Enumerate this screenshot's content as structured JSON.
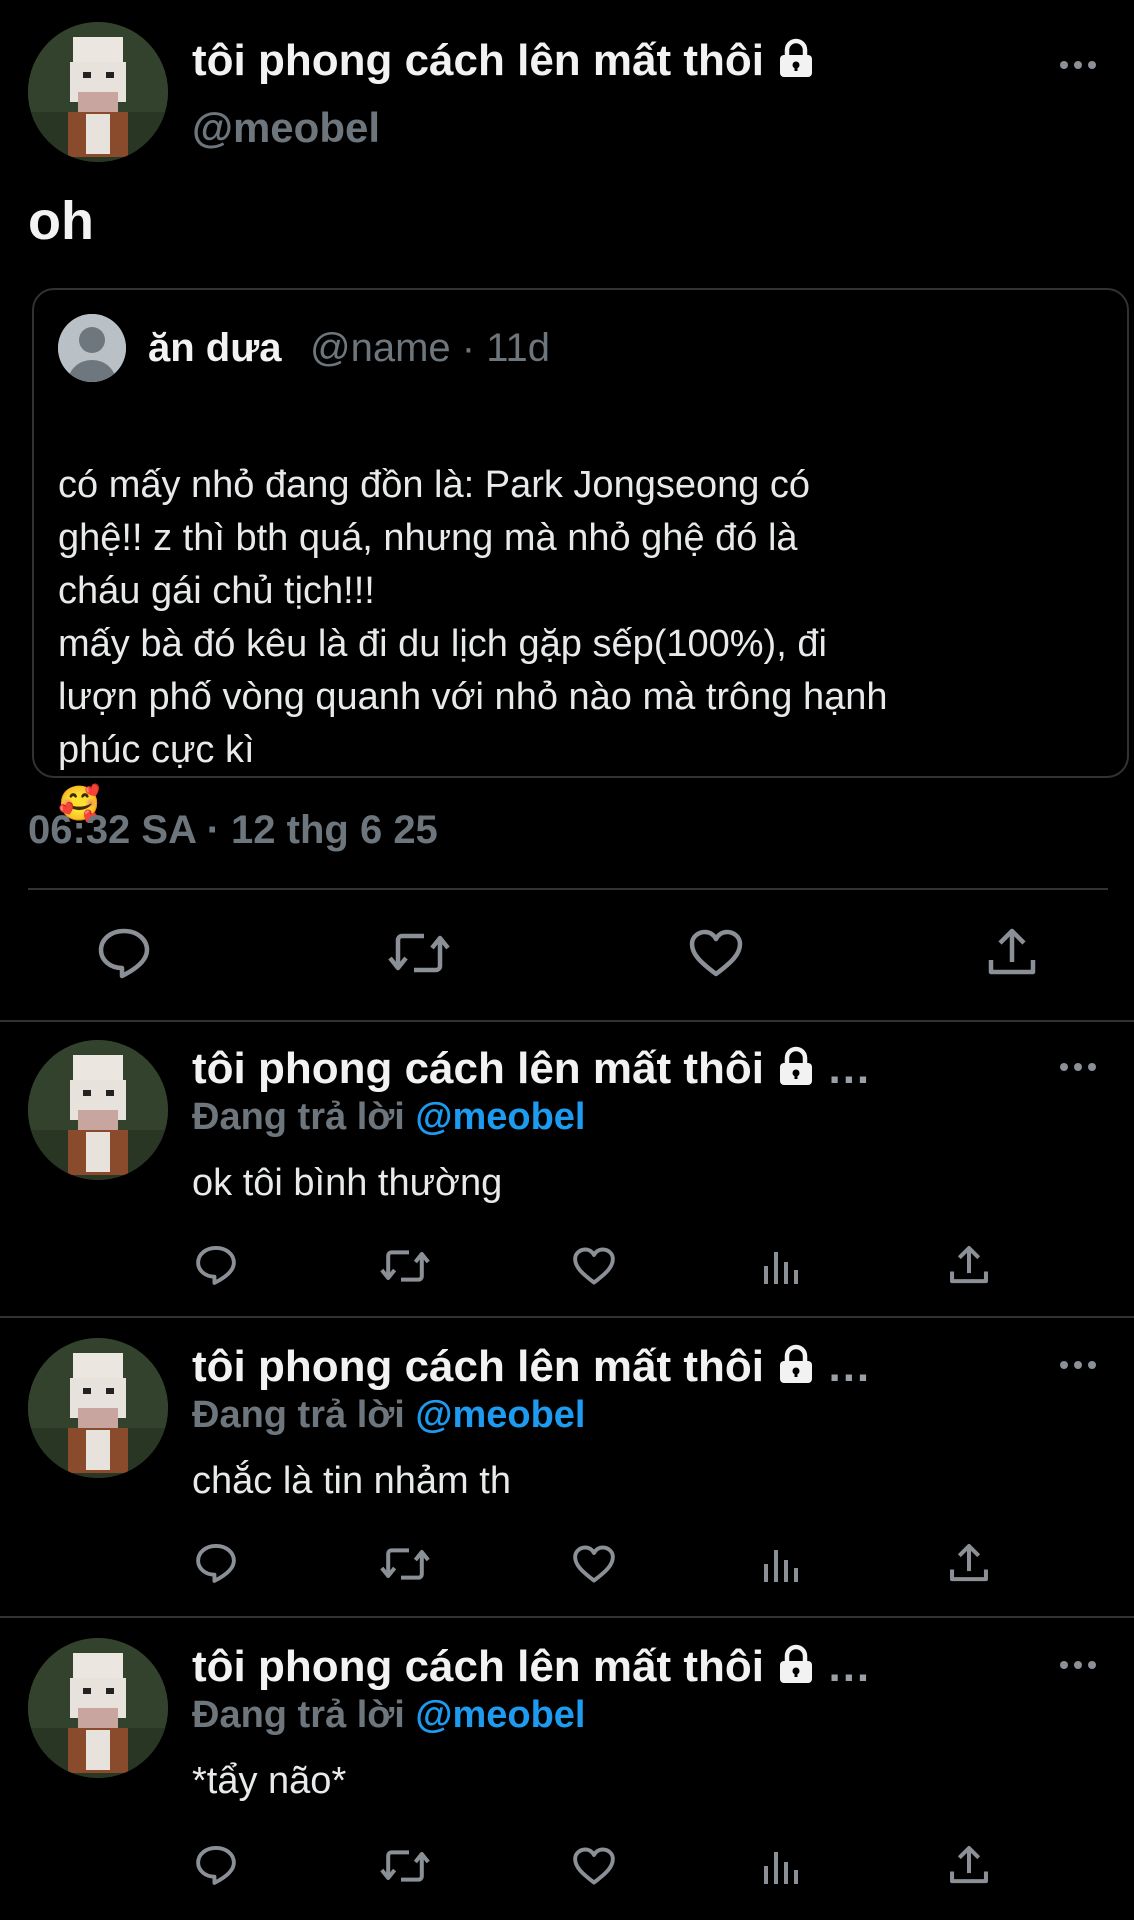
{
  "main_tweet": {
    "display_name": "tôi phong cách lên mất thôi",
    "handle": "@meobel",
    "text": "oh",
    "timestamp": "06:32 SA · 12 thg 6 25",
    "icons": {
      "lock": "lock-icon",
      "more": "more-icon",
      "reply": "reply-icon",
      "retweet": "retweet-icon",
      "like": "like-icon",
      "share": "share-icon"
    }
  },
  "quoted_tweet": {
    "display_name": "ăn dưa",
    "handle_time": "@name · 11d",
    "text": "có mấy nhỏ đang đồn là: Park Jongseong có\nghệ!! z thì bth quá, nhưng mà nhỏ ghệ đó là\ncháu gái chủ tịch!!!\nmấy bà đó kêu là đi du lịch gặp sếp(100%), đi\nlượn phố vòng quanh với nhỏ nào mà trông hạnh\nphúc cực kì",
    "emoji": "🥰"
  },
  "replies": [
    {
      "display_name": "tôi phong cách lên mất thôi",
      "ellipsis": "...",
      "replying_prefix": "Đang trả lời",
      "replying_handle": "@meobel",
      "text": "ok tôi bình thường"
    },
    {
      "display_name": "tôi phong cách lên mất thôi",
      "ellipsis": "...",
      "replying_prefix": "Đang trả lời",
      "replying_handle": "@meobel",
      "text": "chắc là tin nhảm th"
    },
    {
      "display_name": "tôi phong cách lên mất thôi",
      "ellipsis": "...",
      "replying_prefix": "Đang trả lời",
      "replying_handle": "@meobel",
      "text": "*tẩy não*"
    }
  ],
  "colors": {
    "background": "#000000",
    "text": "#e7e9ea",
    "muted": "#6e767d",
    "link": "#1d9bf0",
    "divider": "#2f3336"
  }
}
